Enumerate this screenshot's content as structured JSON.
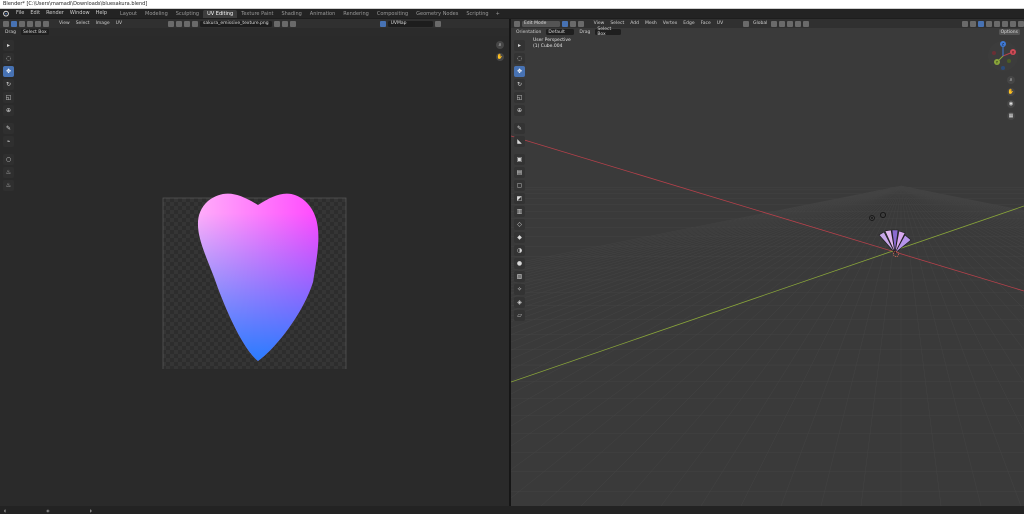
{
  "window": {
    "title": "Blender* [C:\\Users\\mamadi\\Downloads\\bluesakura.blend]"
  },
  "menubar": {
    "menus": [
      "File",
      "Edit",
      "Render",
      "Window",
      "Help"
    ],
    "workspaces": [
      "Layout",
      "Modeling",
      "Sculpting",
      "UV Editing",
      "Texture Paint",
      "Shading",
      "Animation",
      "Rendering",
      "Compositing",
      "Geometry Nodes",
      "Scripting"
    ],
    "active_workspace": "UV Editing",
    "add_tab": "+"
  },
  "uv_editor": {
    "header_menus": [
      "View",
      "Select",
      "Image",
      "UV"
    ],
    "image_name": "sakura_emissive_texture.png",
    "uv_map": "UVMap",
    "sub_menus": [
      "Drag",
      "Select Box"
    ],
    "tools": [
      "cursor",
      "tweak",
      "select-box",
      "move",
      "rotate",
      "scale",
      "transform",
      "annotate",
      "rip",
      "grab",
      "relax",
      "pinch"
    ]
  },
  "viewport": {
    "mode": "Edit Mode",
    "header_menus": [
      "View",
      "Select",
      "Add",
      "Mesh",
      "Vertex",
      "Edge",
      "Face",
      "UV"
    ],
    "transform_orientation": "Global",
    "options_label": "Options",
    "orientation_label": "Orientation",
    "orientation_value": "Default",
    "drag_label": "Drag",
    "select_box": "Select Box",
    "view_name": "User Perspective",
    "object_name": "(1) Cube.004",
    "gizmo_axes": [
      "X",
      "Y",
      "Z"
    ],
    "colors": {
      "x_axis": "#b8414b",
      "y_axis": "#8aa63a",
      "z_axis": "#3f7ad6"
    }
  },
  "colors": {
    "accent": "#4772b3",
    "petal_top_left": "#ffc9f7",
    "petal_top_right": "#ff2bff",
    "petal_bottom": "#1e7cff"
  }
}
